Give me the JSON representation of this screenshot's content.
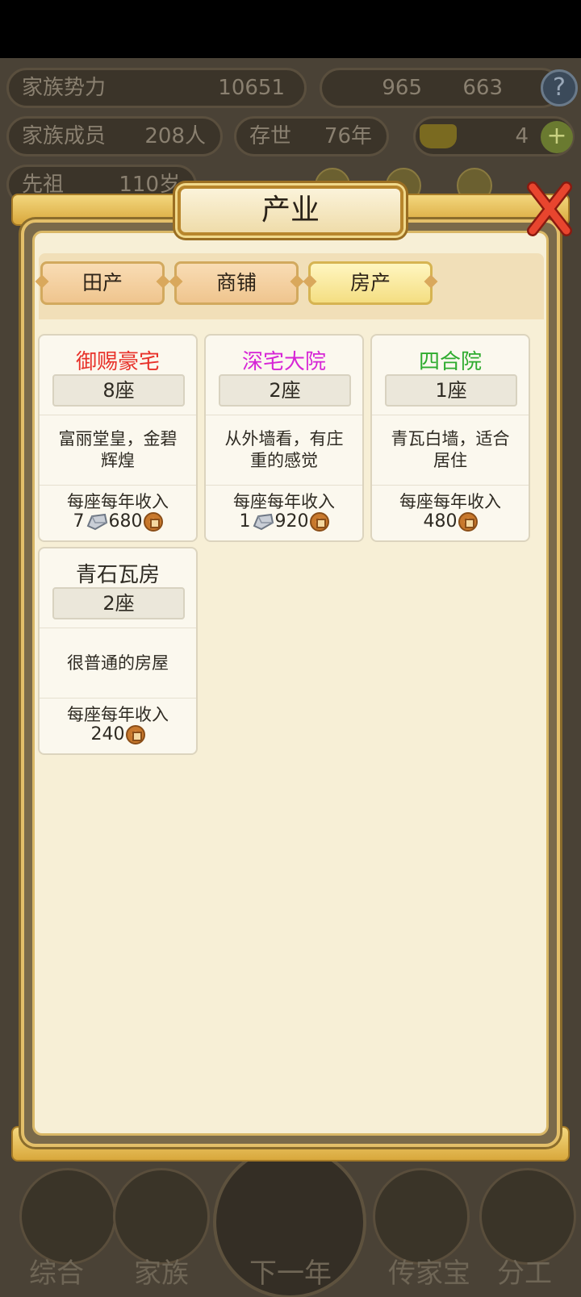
{
  "background": {
    "family_power_label": "家族势力",
    "family_power_value": "10651",
    "family_members_label": "家族成员",
    "family_members_value": "208人",
    "alive_label": "存世",
    "alive_value": "76年",
    "ancestor_label": "先祖",
    "ancestor_value": "110岁",
    "silver_amount": "965",
    "copper_amount": "663",
    "gold_amount": "4",
    "help_glyph": "?"
  },
  "nav": {
    "items": [
      "综合",
      "家族",
      "下一年",
      "传家宝",
      "分工"
    ]
  },
  "dialog": {
    "title": "产业",
    "tabs": [
      {
        "label": "田产",
        "active": false
      },
      {
        "label": "商铺",
        "active": false
      },
      {
        "label": "房产",
        "active": true
      }
    ],
    "cards": [
      {
        "name": "御赐豪宅",
        "name_color": "#e8322a",
        "count": "8座",
        "desc": "富丽堂皇，金碧辉煌",
        "income_label": "每座每年收入",
        "silver": "7",
        "copper": "680"
      },
      {
        "name": "深宅大院",
        "name_color": "#d625d6",
        "count": "2座",
        "desc": "从外墙看，有庄重的感觉",
        "income_label": "每座每年收入",
        "silver": "1",
        "copper": "920"
      },
      {
        "name": "四合院",
        "name_color": "#2eab2e",
        "count": "1座",
        "desc": "青瓦白墙，适合居住",
        "income_label": "每座每年收入",
        "silver": "",
        "copper": "480"
      },
      {
        "name": "青石瓦房",
        "name_color": "#2e2a22",
        "count": "2座",
        "desc": "很普通的房屋",
        "income_label": "每座每年收入",
        "silver": "",
        "copper": "240"
      }
    ]
  }
}
